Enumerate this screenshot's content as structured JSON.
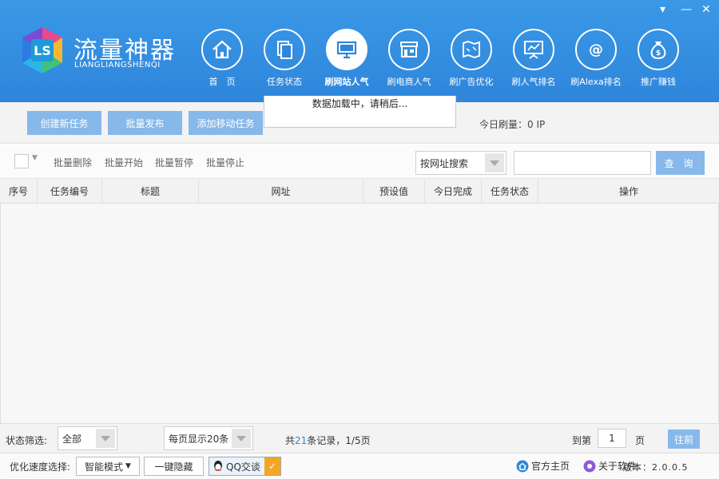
{
  "window": {
    "minimize_glyph": "▾",
    "min_glyph": "—",
    "close_glyph": "✕"
  },
  "brand": {
    "name_cn": "流量神器",
    "name_en": "LIANGLIANGSHENQI",
    "logo_text": "LS",
    "accent": "#2f86db"
  },
  "nav": [
    {
      "label": "首　页",
      "icon": "home-icon"
    },
    {
      "label": "任务状态",
      "icon": "documents-icon"
    },
    {
      "label": "刷网站人气",
      "icon": "monitor-icon",
      "active": true
    },
    {
      "label": "刷电商人气",
      "icon": "store-icon"
    },
    {
      "label": "刷广告优化",
      "icon": "map-icon"
    },
    {
      "label": "刷人气排名",
      "icon": "chart-board-icon"
    },
    {
      "label": "刷Alexa排名",
      "icon": "at-icon"
    },
    {
      "label": "推广赚钱",
      "icon": "money-bag-icon"
    }
  ],
  "toolbar": {
    "create_task": "创建新任务",
    "batch_publish": "批量发布",
    "add_mobile_task": "添加移动任务",
    "loading_text": "数据加载中，请稍后...",
    "today_views": "今日刷量：0 IP"
  },
  "actions": {
    "batch_delete": "批量删除",
    "batch_start": "批量开始",
    "batch_pause": "批量暂停",
    "batch_stop": "批量停止",
    "search_by": "按网址搜索",
    "search_value": "",
    "query": "查 询"
  },
  "table": {
    "columns": [
      "序号",
      "任务编号",
      "标题",
      "网址",
      "预设值",
      "今日完成",
      "任务状态",
      "操作"
    ],
    "rows": []
  },
  "pager": {
    "status_filter_label": "状态筛选:",
    "status_filter_value": "全部",
    "page_size": "每页显示20条",
    "total_prefix": "共",
    "total_count": "21",
    "total_suffix": "条记录，1/5页",
    "goto_prefix": "到第",
    "goto_page": "1",
    "goto_suffix": "页",
    "go": "往前"
  },
  "footer": {
    "speed_label": "优化速度选择:",
    "speed_mode": "智能模式",
    "hide": "一键隐藏",
    "qq": "QQ交谈",
    "home": "官方主页",
    "about": "关于软件",
    "version": "版本：2.0.0.5"
  }
}
